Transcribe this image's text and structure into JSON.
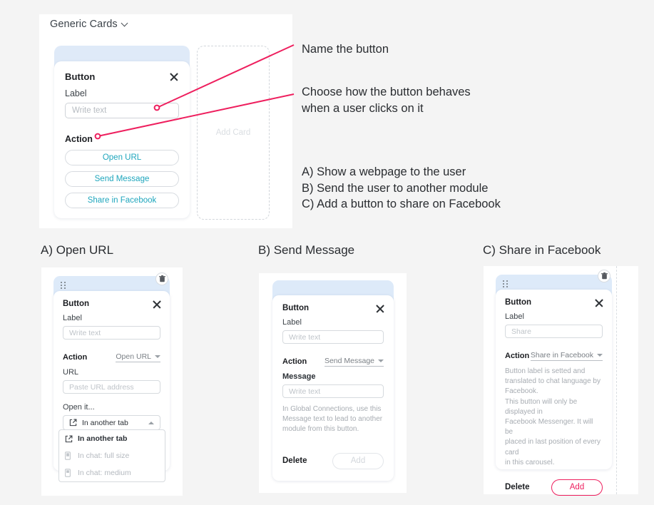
{
  "top_panel": {
    "header_label": "Generic Cards",
    "header_icon": "chevron-down-icon",
    "card": {
      "title": "Button",
      "close_icon": "close-icon",
      "label_field_label": "Label",
      "label_field_placeholder": "Write text",
      "label_field_value": "",
      "action_label": "Action",
      "action_options": [
        "Open URL",
        "Send Message",
        "Share in Facebook"
      ]
    },
    "add_card_label": "Add Card"
  },
  "annotations": {
    "name_the_button": "Name the button",
    "choose_behaviour": "Choose how the button behaves\nwhen a user clicks on it",
    "options_list": "A) Show a webpage to the user\nB) Send the user to another module\nC) Add a button to share on Facebook"
  },
  "panels": {
    "a": {
      "heading": "A) Open URL",
      "drag_icon": "drag-handle-icon",
      "trash_icon": "trash-icon",
      "title": "Button",
      "close_icon": "close-icon",
      "label_field_label": "Label",
      "label_field_placeholder": "Write text",
      "action_label": "Action",
      "action_value": "Open URL",
      "action_caret": "chevron-up-icon",
      "url_field_label": "URL",
      "url_field_placeholder": "Paste URL address",
      "open_it_label": "Open it...",
      "open_it_value": "In another tab",
      "open_it_icon": "external-link-icon",
      "dropdown_options": [
        {
          "label": "In another tab",
          "icon": "external-link-icon",
          "selected": true
        },
        {
          "label": "In chat: full size",
          "icon": "mobile-icon",
          "selected": false
        },
        {
          "label": "In chat: medium",
          "icon": "mobile-icon",
          "selected": false
        }
      ]
    },
    "b": {
      "heading": "B) Send Message",
      "title": "Button",
      "close_icon": "close-icon",
      "label_field_label": "Label",
      "label_field_placeholder": "Write text",
      "action_label": "Action",
      "action_value": "Send Message",
      "action_caret": "chevron-down-icon",
      "message_field_label": "Message",
      "message_field_placeholder": "Write text",
      "help_text": "In Global Connections, use this\nMessage text to lead to another\nmodule from this button.",
      "delete_label": "Delete",
      "add_label": "Add",
      "add_enabled": false
    },
    "c": {
      "heading": "C) Share in Facebook",
      "drag_icon": "drag-handle-icon",
      "trash_icon": "trash-icon",
      "title": "Button",
      "close_icon": "close-icon",
      "label_field_label": "Label",
      "label_field_placeholder": "Share",
      "action_label": "Action",
      "action_value": "Share in Facebook",
      "action_caret": "chevron-down-icon",
      "help_text": "Button label is setted and\ntranslated to chat language by\nFacebook.\nThis button will only be displayed in\nFacebook Messenger. It will be\nplaced in last position of every card\nin this carousel.",
      "delete_label": "Delete",
      "add_label": "Add",
      "add_enabled": true
    }
  },
  "colors": {
    "accent_pink": "#ee1f5e",
    "accent_teal": "#1fa6bd",
    "card_header_blue": "#ddeaf9",
    "page_background": "#f4f4f4"
  }
}
